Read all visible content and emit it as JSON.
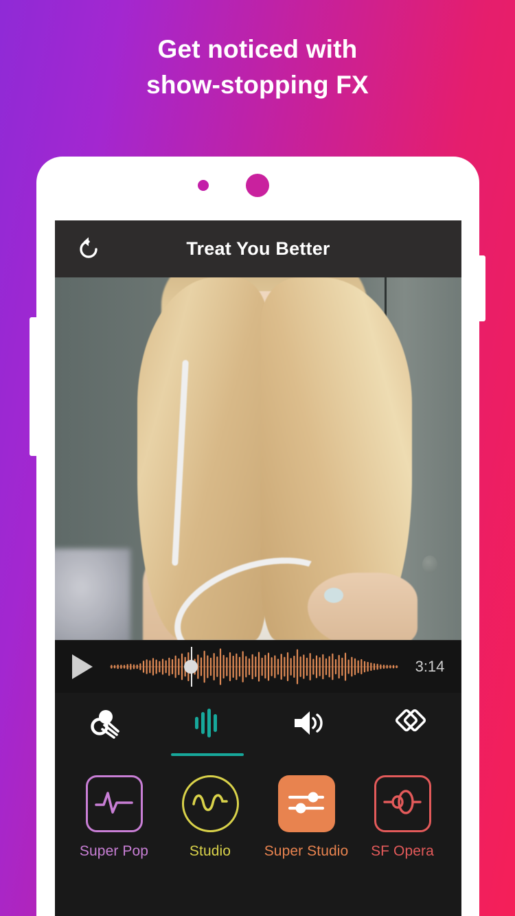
{
  "promo": {
    "headline_line1": "Get noticed with",
    "headline_line2": "show-stopping FX",
    "text_color": "#ffffff",
    "gradient_from": "#8f2ad6",
    "gradient_to": "#f51f58"
  },
  "device": {
    "body_color": "#ffffff",
    "camera_dot_color": "#c31fa8",
    "speaker_dot_color": "#c9219e"
  },
  "app": {
    "titlebar": {
      "title": "Treat You Better",
      "redo_icon": "rotate-ccw-icon",
      "background": "#2e2c2c"
    },
    "player": {
      "play_icon": "play-icon",
      "duration": "3:14",
      "waveform_color": "#e08a55",
      "playhead_percent": 28,
      "playhead_color": "#dcdcdc",
      "waveform_peaks": [
        0.06,
        0.05,
        0.08,
        0.07,
        0.06,
        0.1,
        0.12,
        0.09,
        0.08,
        0.14,
        0.28,
        0.35,
        0.3,
        0.42,
        0.34,
        0.26,
        0.38,
        0.3,
        0.44,
        0.36,
        0.55,
        0.4,
        0.66,
        0.48,
        0.72,
        0.52,
        0.38,
        0.6,
        0.45,
        0.8,
        0.56,
        0.44,
        0.68,
        0.5,
        0.92,
        0.58,
        0.46,
        0.72,
        0.54,
        0.66,
        0.48,
        0.78,
        0.52,
        0.4,
        0.62,
        0.5,
        0.74,
        0.44,
        0.58,
        0.7,
        0.46,
        0.56,
        0.38,
        0.64,
        0.48,
        0.72,
        0.42,
        0.54,
        0.88,
        0.5,
        0.6,
        0.44,
        0.68,
        0.38,
        0.56,
        0.46,
        0.62,
        0.4,
        0.52,
        0.66,
        0.36,
        0.58,
        0.44,
        0.7,
        0.34,
        0.48,
        0.4,
        0.3,
        0.36,
        0.26,
        0.22,
        0.18,
        0.14,
        0.12,
        0.09,
        0.07,
        0.06,
        0.05,
        0.05,
        0.04
      ]
    },
    "tabs": [
      {
        "name": "vocal-fx-tab",
        "icon": "whistle-icon",
        "active": false
      },
      {
        "name": "voice-fx-tab",
        "icon": "equalizer-icon",
        "active": true
      },
      {
        "name": "volume-tab",
        "icon": "speaker-icon",
        "active": false
      },
      {
        "name": "layers-fx-tab",
        "icon": "diamonds-icon",
        "active": false
      }
    ],
    "active_tab_color": "#17a89b",
    "fx_presets": [
      {
        "label": "Super Pop",
        "icon": "pulse-wave-icon",
        "color": "#c97fd6",
        "selected": false,
        "style": "outline"
      },
      {
        "label": "Studio",
        "icon": "sine-wave-icon",
        "color": "#d9d martin",
        "selected": false,
        "style": "outline"
      },
      {
        "label": "Super Studio",
        "icon": "sliders-icon",
        "color": "#e8834f",
        "selected": true,
        "style": "filled"
      },
      {
        "label": "SF Opera",
        "icon": "opera-wave-icon",
        "color": "#e35a5a",
        "selected": false,
        "style": "outline"
      }
    ],
    "fx_preset_colors": {
      "super_pop": "#c97fd6",
      "studio": "#d9d24a",
      "super_studio": "#e8834f",
      "sf_opera": "#e35a5a"
    },
    "background": "#191919"
  }
}
